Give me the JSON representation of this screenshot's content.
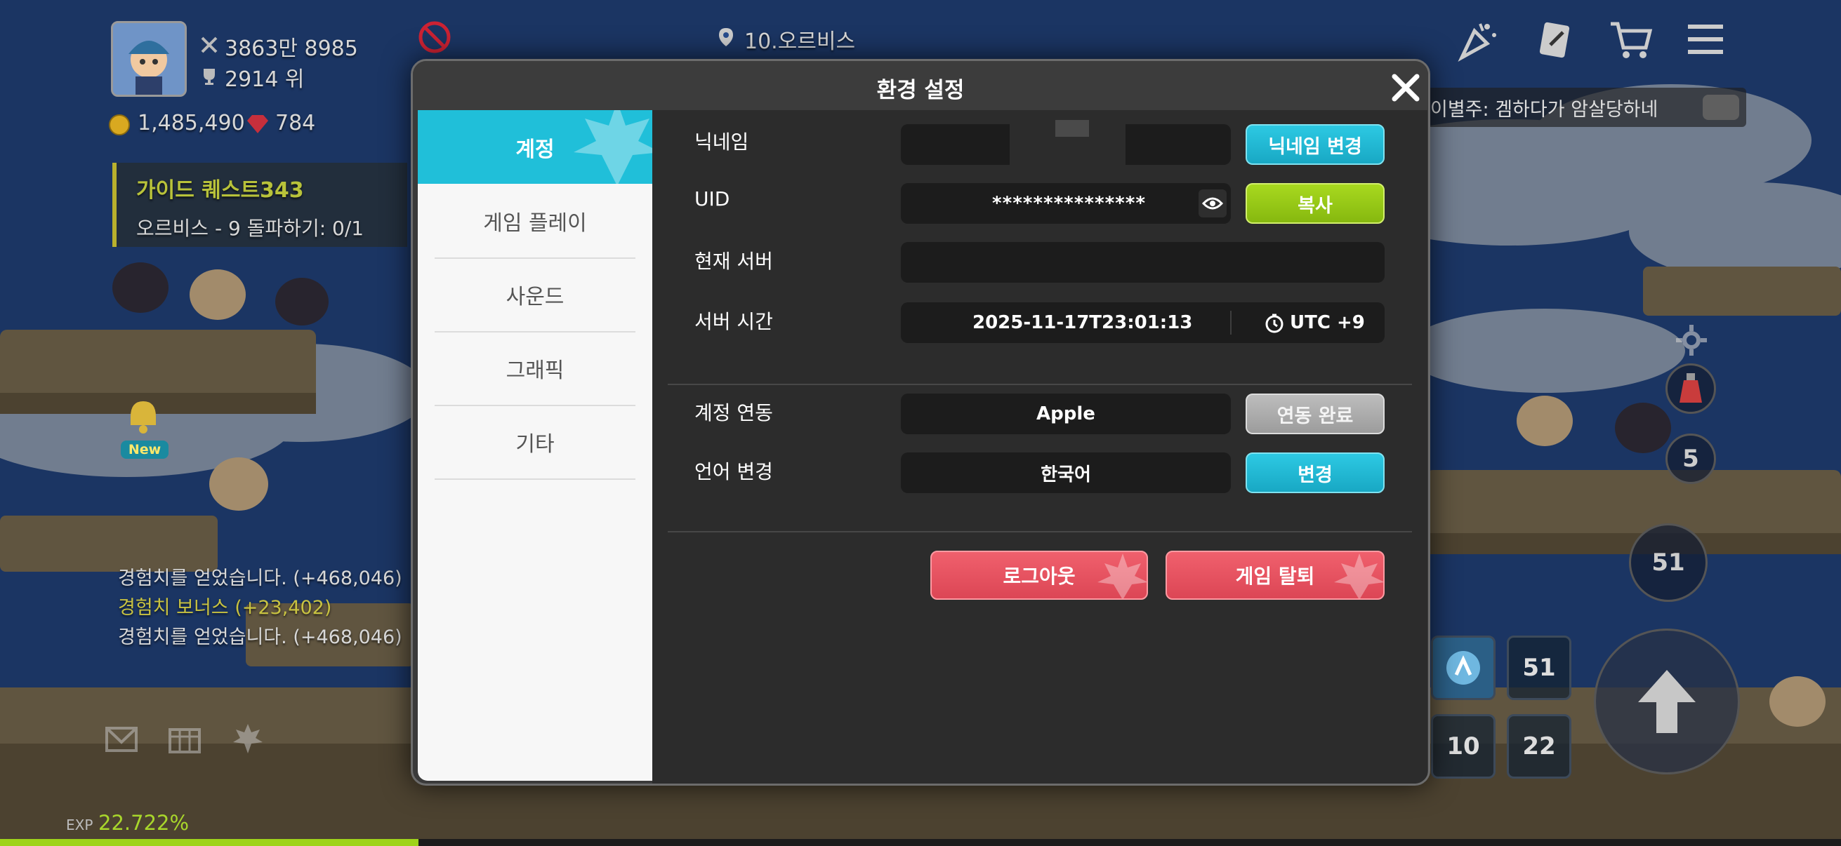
{
  "hud": {
    "combat_power": "3863만 8985",
    "rank": "2914 위",
    "mesos": "1,485,490",
    "gems": "784",
    "location": "10.오르비스",
    "quest_title": "가이드 퀘스트343",
    "quest_desc": "오르비스 - 9 돌파하기: 0/1",
    "new_badge": "New",
    "chat_text": "이별주: 겜하다가 암살당하네",
    "exp_label": "EXP",
    "exp_value": "22.722%",
    "exp_fraction": 0.22722,
    "side_count": "5",
    "level_badge": "51",
    "skill_slots": [
      "51",
      "10",
      "22"
    ],
    "log_lines": [
      "경험치를 얻었습니다. (+468,046)",
      "경험치 보너스 (+23,402)",
      "경험치를 얻었습니다. (+468,046)"
    ]
  },
  "modal": {
    "title": "환경 설정",
    "close_icon": "close-icon",
    "tabs": [
      {
        "label": "계정",
        "active": true
      },
      {
        "label": "게임 플레이",
        "active": false
      },
      {
        "label": "사운드",
        "active": false
      },
      {
        "label": "그래픽",
        "active": false
      },
      {
        "label": "기타",
        "active": false
      }
    ],
    "account": {
      "nickname_label": "닉네임",
      "nickname_button": "닉네임 변경",
      "uid_label": "UID",
      "uid_value": "***************",
      "uid_copy_button": "복사",
      "server_label": "현재 서버",
      "server_time_label": "서버 시간",
      "server_time_value": "2025-11-17T23:01:13",
      "timezone": "UTC +9",
      "link_label": "계정 연동",
      "link_value": "Apple",
      "link_button": "연동 완료",
      "language_label": "언어 변경",
      "language_value": "한국어",
      "language_button": "변경",
      "logout_button": "로그아웃",
      "withdraw_button": "게임 탈퇴"
    }
  },
  "colors": {
    "accent_cyan": "#20bfd9",
    "copy_green": "#9bcc17",
    "danger_red": "#e84f5d",
    "linked_gray": "#acacac"
  }
}
